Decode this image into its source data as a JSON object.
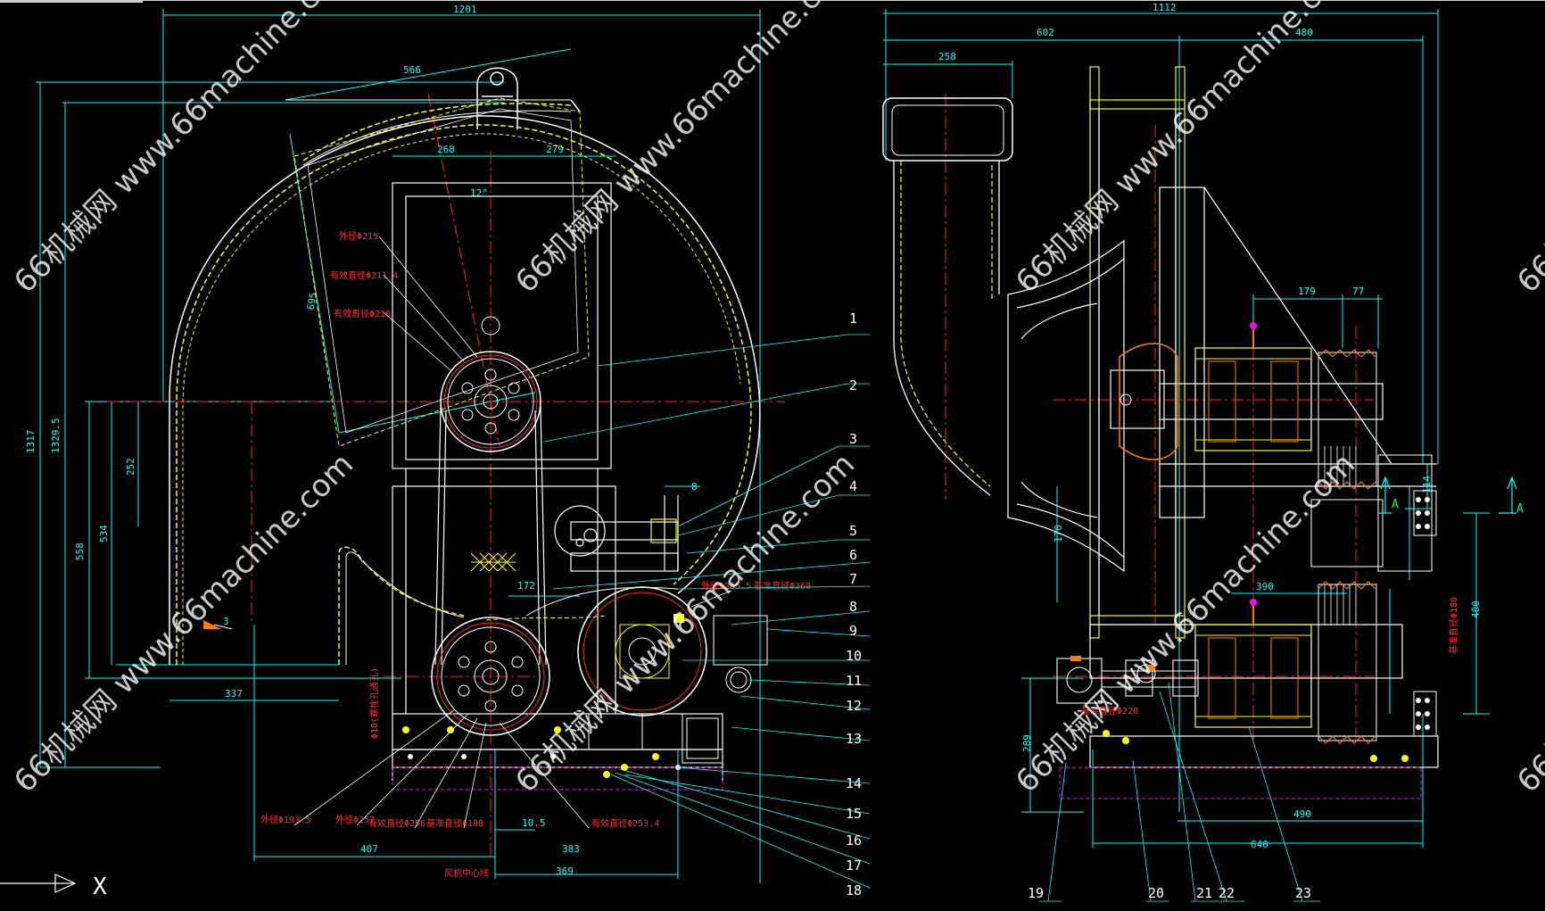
{
  "watermark": "66机械网 www.66machine.com",
  "left_view": {
    "dims_top": [
      "1201",
      "566",
      "268",
      "279",
      "12°"
    ],
    "dims_side": [
      "1317",
      "1329.5",
      "558",
      "534",
      "252",
      "695"
    ],
    "dims_bottom": [
      "337",
      "172",
      "8",
      "407",
      "383",
      "10.5",
      "369"
    ],
    "red_labels": [
      "外径Φ215",
      "有效直径Φ211.4",
      "有效直径Φ216",
      "外径Φ193.5",
      "外径Φ257",
      "有效直径Φ256",
      "基准直径Φ188",
      "有效直径Φ253.4",
      "外径Φ265.5",
      "基准直径Φ268",
      "Φ10(螺栓孔通孔)",
      "风机中心线"
    ],
    "callouts": [
      "1",
      "2",
      "3",
      "4",
      "5",
      "6",
      "7",
      "8",
      "9",
      "10",
      "11",
      "12",
      "13",
      "14",
      "15",
      "16",
      "17",
      "18"
    ]
  },
  "right_view": {
    "dims_top": [
      "1112",
      "602",
      "480",
      "258",
      "179",
      "77"
    ],
    "dims_side": [
      "114",
      "170",
      "400",
      "390",
      "289"
    ],
    "dims_bottom": [
      "490",
      "640"
    ],
    "red_labels": [
      "基准直径Φ220",
      "基准直径Φ180"
    ],
    "section_marks": [
      "A",
      "A"
    ],
    "callouts": [
      "19",
      "20",
      "21",
      "22",
      "23"
    ]
  },
  "ucs": {
    "x_label": "X"
  },
  "colors": {
    "background": "#000000",
    "dimension": "#00ffff",
    "outline": "#ffffff",
    "hidden": "#ffff00",
    "center": "#ff2020",
    "hatch": "#ff00ff"
  }
}
